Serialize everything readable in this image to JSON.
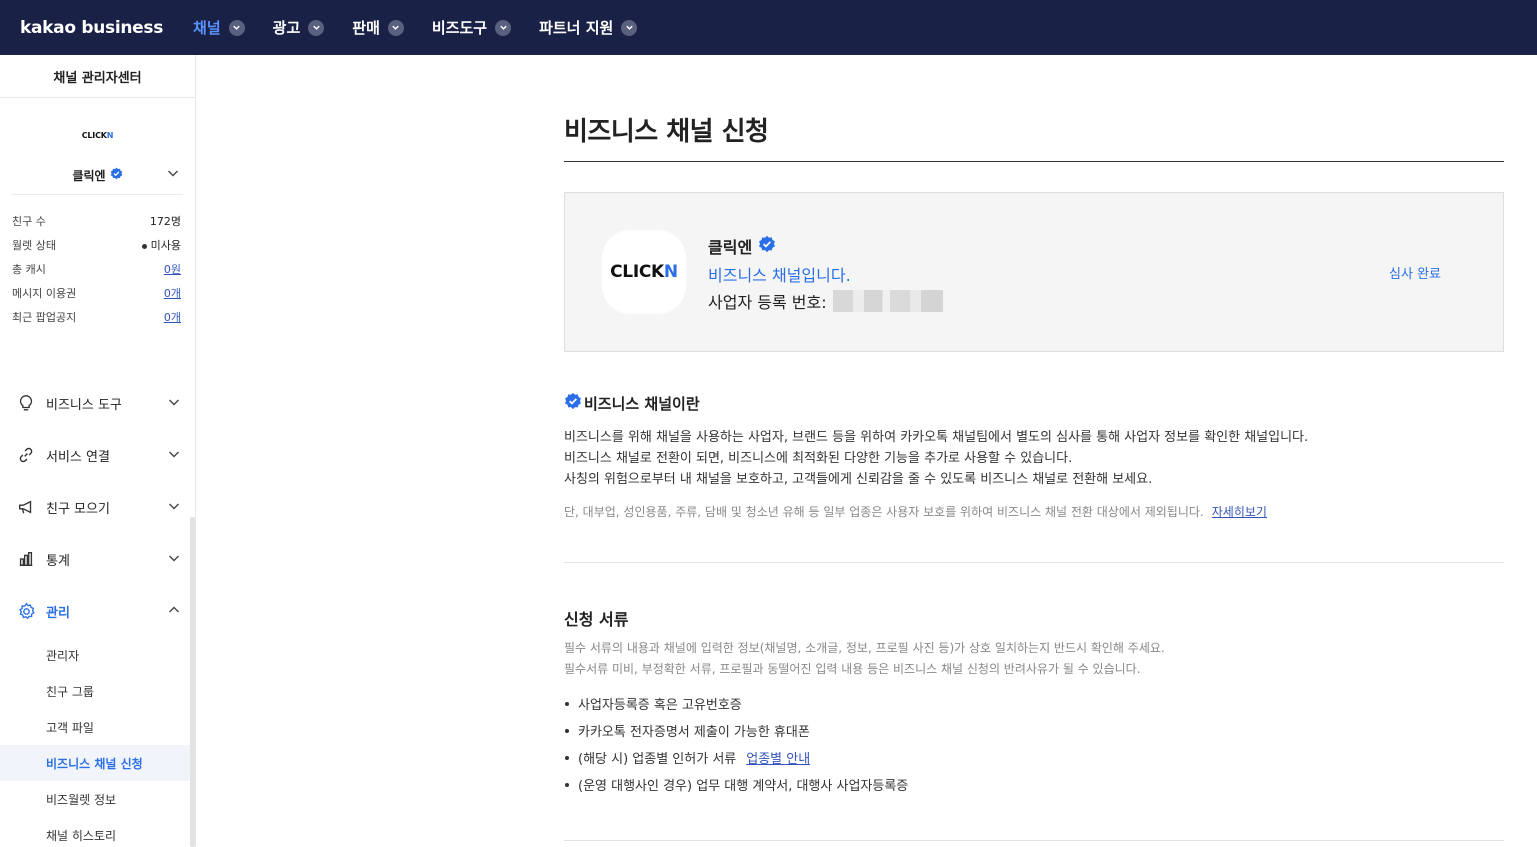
{
  "topnav": {
    "brand": "kakao business",
    "items": [
      {
        "label": "채널",
        "active": true
      },
      {
        "label": "광고",
        "active": false
      },
      {
        "label": "판매",
        "active": false
      },
      {
        "label": "비즈도구",
        "active": false
      },
      {
        "label": "파트너 지원",
        "active": false
      }
    ]
  },
  "sidebar": {
    "title": "채널 관리자센터",
    "logo_text": "CLICK",
    "logo_accent": "N",
    "channel_name": "클릭엔",
    "stats": [
      {
        "label": "친구 수",
        "value": "172명"
      },
      {
        "label": "월렛 상태",
        "value": "미사용"
      },
      {
        "label": "총 캐시",
        "value": "0원"
      },
      {
        "label": "메시지 이용권",
        "value": "0개"
      },
      {
        "label": "최근 팝업공지",
        "value": "0개"
      }
    ],
    "menu": [
      {
        "label": "비즈니스 도구",
        "icon": "lightbulb-icon"
      },
      {
        "label": "서비스 연결",
        "icon": "link-icon"
      },
      {
        "label": "친구 모으기",
        "icon": "megaphone-icon"
      },
      {
        "label": "통계",
        "icon": "bar-chart-icon"
      },
      {
        "label": "관리",
        "icon": "gear-icon"
      }
    ],
    "submenu": [
      "관리자",
      "친구 그룹",
      "고객 파일",
      "비즈니스 채널 신청",
      "비즈월렛 정보",
      "채널 히스토리"
    ]
  },
  "main": {
    "page_title": "비즈니스 채널 신청",
    "card": {
      "logo_text": "CLICK",
      "logo_accent": "N",
      "name": "클릭엔",
      "type": "비즈니스 채널입니다.",
      "biz_label": "사업자 등록 번호:",
      "status": "심사 완료"
    },
    "section1": {
      "title": "비즈니스 채널이란",
      "lines": [
        "비즈니스를 위해 채널을 사용하는 사업자, 브랜드 등을 위하여 카카오톡 채널팀에서 별도의 심사를 통해 사업자 정보를 확인한 채널입니다.",
        "비즈니스 채널로 전환이 되면, 비즈니스에 최적화된 다양한 기능을 추가로 사용할 수 있습니다.",
        "사칭의 위험으로부터 내 채널을 보호하고, 고객들에게 신뢰감을 줄 수 있도록 비즈니스 채널로 전환해 보세요."
      ],
      "note": "단, 대부업, 성인용품, 주류, 담배 및 청소년 유해 등 일부 업종은 사용자 보호를 위하여 비즈니스 채널 전환 대상에서 제외됩니다.",
      "note_link": "자세히보기"
    },
    "section2": {
      "title": "신청 서류",
      "desc": [
        "필수 서류의 내용과 채널에 입력한 정보(채널명, 소개글, 정보, 프로필 사진 등)가 상호 일치하는지 반드시 확인해 주세요.",
        "필수서류 미비, 부정확한 서류, 프로필과 동떨어진 입력 내용 등은 비즈니스 채널 신청의 반려사유가 될 수 있습니다."
      ],
      "items": [
        {
          "text": "사업자등록증 혹은 고유번호증",
          "link": ""
        },
        {
          "text": "카카오톡 전자증명서 제출이 가능한 휴대폰",
          "link": ""
        },
        {
          "text": "(해당 시) 업종별 인허가 서류",
          "link": "업종별 안내"
        },
        {
          "text": "(운영 대행사인 경우) 업무 대행 계약서, 대행사 사업자등록증",
          "link": ""
        }
      ]
    }
  },
  "colors": {
    "nav_bg": "#1a2146",
    "accent": "#2b6fe8",
    "verify": "#2b6fe8"
  }
}
